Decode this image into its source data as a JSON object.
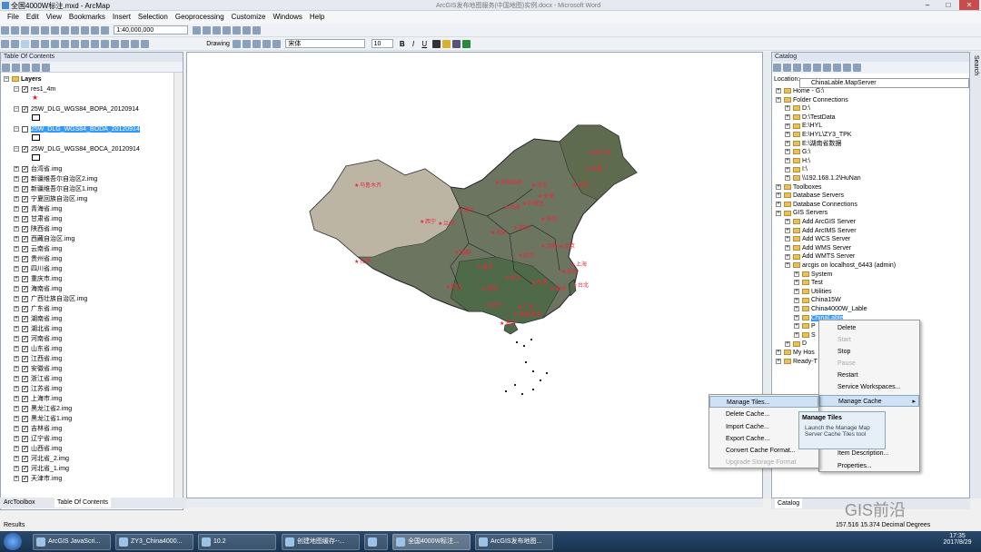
{
  "window": {
    "title": "全国4000W标注.mxd - ArcMap",
    "center_title": "ArcGIS发布地图服务(中国地图)实例.docx - Microsoft Word"
  },
  "menu": [
    "File",
    "Edit",
    "View",
    "Bookmarks",
    "Insert",
    "Selection",
    "Geoprocessing",
    "Customize",
    "Windows",
    "Help"
  ],
  "toolbar": {
    "scale": "1:40,000,000",
    "drawing": "Drawing",
    "font": "宋体",
    "size": "10",
    "bold": "B",
    "italic": "I",
    "underline": "U"
  },
  "toc": {
    "title": "Table Of Contents",
    "root": "Layers",
    "layers": [
      "res1_4m",
      "25W_DLG_WGS84_BOPA_20120914",
      "25W_DLG_WGS84_BODA_20120914",
      "25W_DLG_WGS84_BOCA_20120914",
      "台湾省.img",
      "新疆维吾尔自治区2.img",
      "新疆维吾尔自治区1.img",
      "宁夏回族自治区.img",
      "青海省.img",
      "甘肃省.img",
      "陕西省.img",
      "西藏自治区.img",
      "云南省.img",
      "贵州省.img",
      "四川省.img",
      "重庆市.img",
      "海南省.img",
      "广西壮族自治区.img",
      "广东省.img",
      "湖南省.img",
      "湖北省.img",
      "河南省.img",
      "山东省.img",
      "江西省.img",
      "安徽省.img",
      "浙江省.img",
      "江苏省.img",
      "上海市.img",
      "黑龙江省2.img",
      "黑龙江省1.img",
      "吉林省.img",
      "辽宁省.img",
      "山西省.img",
      "河北省_2.img",
      "河北省_1.img",
      "天津市.img"
    ],
    "bottom_tabs": [
      "ArcToolbox",
      "Table Of Contents"
    ]
  },
  "catalog": {
    "title": "Catalog",
    "location_label": "Location:",
    "location": "ChinaLable.MapServer",
    "items": [
      {
        "t": "Home - G:\\",
        "d": 0
      },
      {
        "t": "Folder Connections",
        "d": 0
      },
      {
        "t": "D:\\",
        "d": 1
      },
      {
        "t": "D:\\TestData",
        "d": 1
      },
      {
        "t": "E:\\HYL",
        "d": 1
      },
      {
        "t": "E:\\HYL\\ZY3_TPK",
        "d": 1
      },
      {
        "t": "E:\\湖南省数据",
        "d": 1
      },
      {
        "t": "G:\\",
        "d": 1
      },
      {
        "t": "H:\\",
        "d": 1
      },
      {
        "t": "I:\\",
        "d": 1
      },
      {
        "t": "\\\\192.168.1.2\\HuNan",
        "d": 1
      },
      {
        "t": "Toolboxes",
        "d": 0
      },
      {
        "t": "Database Servers",
        "d": 0
      },
      {
        "t": "Database Connections",
        "d": 0
      },
      {
        "t": "GIS Servers",
        "d": 0
      },
      {
        "t": "Add ArcGIS Server",
        "d": 1
      },
      {
        "t": "Add ArcIMS Server",
        "d": 1
      },
      {
        "t": "Add WCS Server",
        "d": 1
      },
      {
        "t": "Add WMS Server",
        "d": 1
      },
      {
        "t": "Add WMTS Server",
        "d": 1
      },
      {
        "t": "arcgis on localhost_6443 (admin)",
        "d": 1
      },
      {
        "t": "System",
        "d": 2
      },
      {
        "t": "Test",
        "d": 2
      },
      {
        "t": "Utilities",
        "d": 2
      },
      {
        "t": "China15W",
        "d": 2
      },
      {
        "t": "China4000W_Lable",
        "d": 2
      },
      {
        "t": "ChinaLable",
        "d": 2
      },
      {
        "t": "P",
        "d": 2
      },
      {
        "t": "S",
        "d": 2
      },
      {
        "t": "D",
        "d": 1
      },
      {
        "t": "My Hos",
        "d": 0
      },
      {
        "t": "Ready-T",
        "d": 0
      }
    ],
    "bottom_tab": "Catalog",
    "side_tabs": "Search"
  },
  "context_menu": [
    "Delete",
    "Start",
    "Stop",
    "Pause",
    "Restart",
    "Service Workspaces...",
    "Manage Cache",
    "Item Description...",
    "Properties..."
  ],
  "sub_menu": [
    "Manage Tiles...",
    "Delete Cache...",
    "Import Cache...",
    "Export Cache...",
    "Convert Cache Format...",
    "Upgrade Storage Format"
  ],
  "tooltip": {
    "title": "Manage Tiles",
    "body": "Launch the Manage Map Server Cache Tiles tool"
  },
  "status": {
    "coords": "157.516  15.374 Decimal Degrees",
    "results": "Results"
  },
  "watermark": "GIS前沿",
  "taskbar": {
    "items": [
      "ArcGIS JavaScri...",
      "ZY3_China4000...",
      "10.2",
      "创建地图缓存--...",
      "",
      "全国4000W标注...",
      "ArcGIS发布地图..."
    ],
    "time": "17:35",
    "date": "2017/8/29"
  },
  "map_labels": [
    "乌鲁木齐",
    "哈尔滨",
    "长春",
    "沈阳",
    "北京",
    "天津",
    "石家庄",
    "太原",
    "呼和浩特",
    "银川",
    "兰州",
    "西宁",
    "拉萨",
    "成都",
    "重庆",
    "西安",
    "郑州",
    "济南",
    "南京",
    "上海",
    "杭州",
    "合肥",
    "武汉",
    "长沙",
    "南昌",
    "福州",
    "台北",
    "广州",
    "南宁",
    "贵阳",
    "昆明",
    "海口",
    "香港",
    "澳门"
  ]
}
